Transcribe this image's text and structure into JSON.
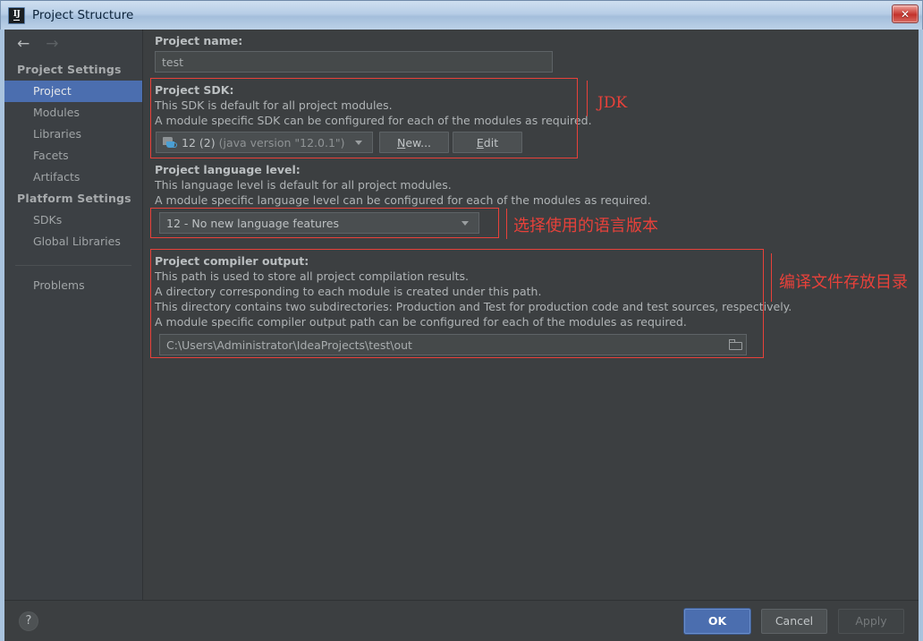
{
  "window": {
    "title": "Project Structure",
    "icon": "intellij-idea-icon",
    "close_label": "✕"
  },
  "nav": {
    "back_icon": "arrow-left-icon",
    "forward_icon": "arrow-right-icon"
  },
  "sidebar": {
    "groups": [
      {
        "title": "Project Settings",
        "items": [
          {
            "label": "Project",
            "selected": true
          },
          {
            "label": "Modules",
            "selected": false
          },
          {
            "label": "Libraries",
            "selected": false
          },
          {
            "label": "Facets",
            "selected": false
          },
          {
            "label": "Artifacts",
            "selected": false
          }
        ]
      },
      {
        "title": "Platform Settings",
        "items": [
          {
            "label": "SDKs",
            "selected": false
          },
          {
            "label": "Global Libraries",
            "selected": false
          }
        ]
      }
    ],
    "extra_items": [
      {
        "label": "Problems",
        "selected": false
      }
    ]
  },
  "main": {
    "project_name": {
      "label": "Project name:",
      "value": "test"
    },
    "project_sdk": {
      "label": "Project SDK:",
      "desc1": "This SDK is default for all project modules.",
      "desc2": "A module specific SDK can be configured for each of the modules as required.",
      "selected": "12 (2) (java version \"12.0.1\")",
      "sdk_name": "12 (2)",
      "sdk_version": "(java version \"12.0.1\")",
      "new_button": "New...",
      "new_button_mnemonic": "N",
      "new_button_rest": "ew...",
      "edit_button": "Edit",
      "edit_button_mnemonic": "E",
      "edit_button_rest": "dit",
      "combo_icon": "java-sdk-icon",
      "caret_icon": "chevron-down-icon"
    },
    "language_level": {
      "label": "Project language level:",
      "desc1": "This language level is default for all project modules.",
      "desc2": "A module specific language level can be configured for each of the modules as required.",
      "selected": "12 - No new language features",
      "caret_icon": "chevron-down-icon"
    },
    "compiler_output": {
      "label": "Project compiler output:",
      "desc1": "This path is used to store all project compilation results.",
      "desc2": "A directory corresponding to each module is created under this path.",
      "desc3": "This directory contains two subdirectories: Production and Test for production code and test sources, respectively.",
      "desc4": "A module specific compiler output path can be configured for each of the modules as required.",
      "value": "C:\\Users\\Administrator\\IdeaProjects\\test\\out",
      "browse_icon": "folder-browse-icon"
    }
  },
  "annotations": [
    {
      "text": "JDK",
      "name": "annotation-jdk"
    },
    {
      "text": "选择使用的语言版本",
      "name": "annotation-language-level"
    },
    {
      "text": "编译文件存放目录",
      "name": "annotation-compiler-output"
    }
  ],
  "footer": {
    "help_label": "?",
    "ok_label": "OK",
    "cancel_label": "Cancel",
    "apply_label": "Apply"
  },
  "colors": {
    "accent_blue": "#4b6eaf",
    "annotation_red": "#e8413a",
    "panel_bg": "#3c3f41",
    "sidebar_bg": "#3c4044",
    "titlebar_blue": "#a9c3de"
  }
}
